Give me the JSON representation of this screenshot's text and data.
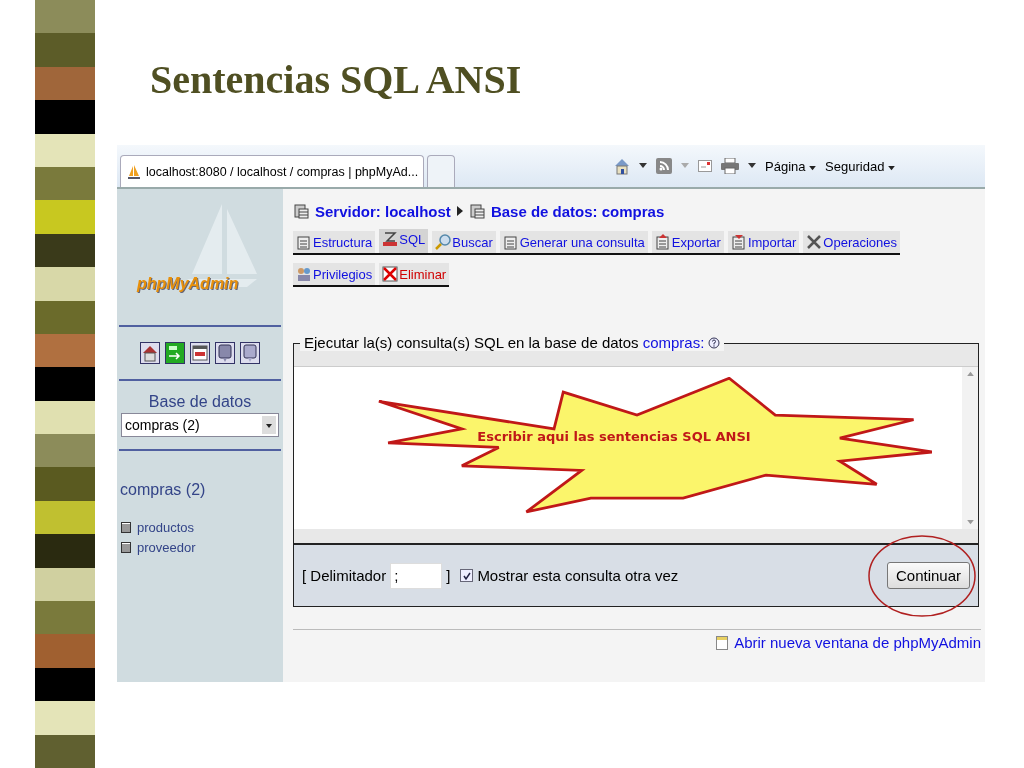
{
  "slide": {
    "title": "Sentencias SQL ANSI"
  },
  "browser": {
    "tab_title": "localhost:8080 / localhost / compras | phpMyAd...",
    "menus": [
      "Página",
      "Seguridad"
    ]
  },
  "sidebar": {
    "logo": "phpMyAdmin",
    "database_label": "Base de datos",
    "database_select": "compras (2)",
    "db_heading": "compras (2)",
    "tables": [
      "productos",
      "proveedor"
    ]
  },
  "breadcrumb": [
    "Servidor: localhost",
    "Base de datos: compras"
  ],
  "tab_rows": [
    [
      {
        "label": "Estructura",
        "selected": false,
        "kind": "normal"
      },
      {
        "label": "SQL",
        "selected": true,
        "kind": "normal"
      },
      {
        "label": "Buscar",
        "selected": false,
        "kind": "normal"
      },
      {
        "label": "Generar una consulta",
        "selected": false,
        "kind": "normal"
      },
      {
        "label": "Exportar",
        "selected": false,
        "kind": "normal"
      },
      {
        "label": "Importar",
        "selected": false,
        "kind": "normal"
      },
      {
        "label": "Operaciones",
        "selected": false,
        "kind": "normal"
      }
    ],
    [
      {
        "label": "Privilegios",
        "selected": false,
        "kind": "normal"
      },
      {
        "label": "Eliminar",
        "selected": false,
        "kind": "danger"
      }
    ]
  ],
  "query": {
    "legend": "Ejecutar la(s) consulta(s) SQL en la base de datos",
    "database_link": "compras:",
    "callout": "Escribir aqui las sentencias SQL ANSI",
    "delimiter_label": "[ Delimitador",
    "delimiter_value": ";",
    "delimiter_close": "]",
    "show_again_checked": true,
    "show_again_label": "Mostrar esta consulta otra vez",
    "submit": "Continuar",
    "submit_circled": true
  },
  "footer_link": "Abrir nueva ventana de phpMyAdmin"
}
